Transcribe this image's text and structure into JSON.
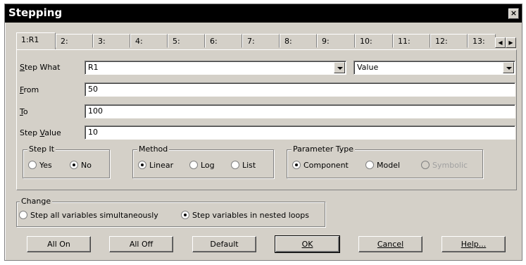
{
  "title": "Stepping",
  "close_glyph": "×",
  "tabs": [
    "1:R1",
    "2:",
    "3:",
    "4:",
    "5:",
    "6:",
    "7:",
    "8:",
    "9:",
    "10:",
    "11:",
    "12:",
    "13:"
  ],
  "tab_scroll": {
    "left": "◀",
    "right": "▶"
  },
  "form": {
    "step_what_label_u": "S",
    "step_what_label_rest": "tep What",
    "step_what_value": "R1",
    "step_what_second": "Value",
    "from_label_u": "F",
    "from_label_rest": "rom",
    "from_value": "50",
    "to_label_u": "T",
    "to_label_rest": "o",
    "to_value": "100",
    "step_value_label_pre": "Step ",
    "step_value_label_u": "V",
    "step_value_label_rest": "alue",
    "step_value_value": "10"
  },
  "step_it": {
    "title": "Step It",
    "options": [
      "Yes",
      "No"
    ],
    "selected": "No"
  },
  "method": {
    "title": "Method",
    "options": [
      "Linear",
      "Log",
      "List"
    ],
    "selected": "Linear"
  },
  "param_type": {
    "title": "Parameter Type",
    "options": [
      "Component",
      "Model",
      "Symbolic"
    ],
    "selected": "Component",
    "disabled": [
      "Symbolic"
    ]
  },
  "change": {
    "title": "Change",
    "options": [
      "Step all variables simultaneously",
      "Step variables in nested loops"
    ],
    "selected": "Step variables in nested loops"
  },
  "buttons": {
    "all_on": "All On",
    "all_off": "All Off",
    "default": "Default",
    "ok": "OK",
    "cancel": "Cancel",
    "help": "Help..."
  }
}
